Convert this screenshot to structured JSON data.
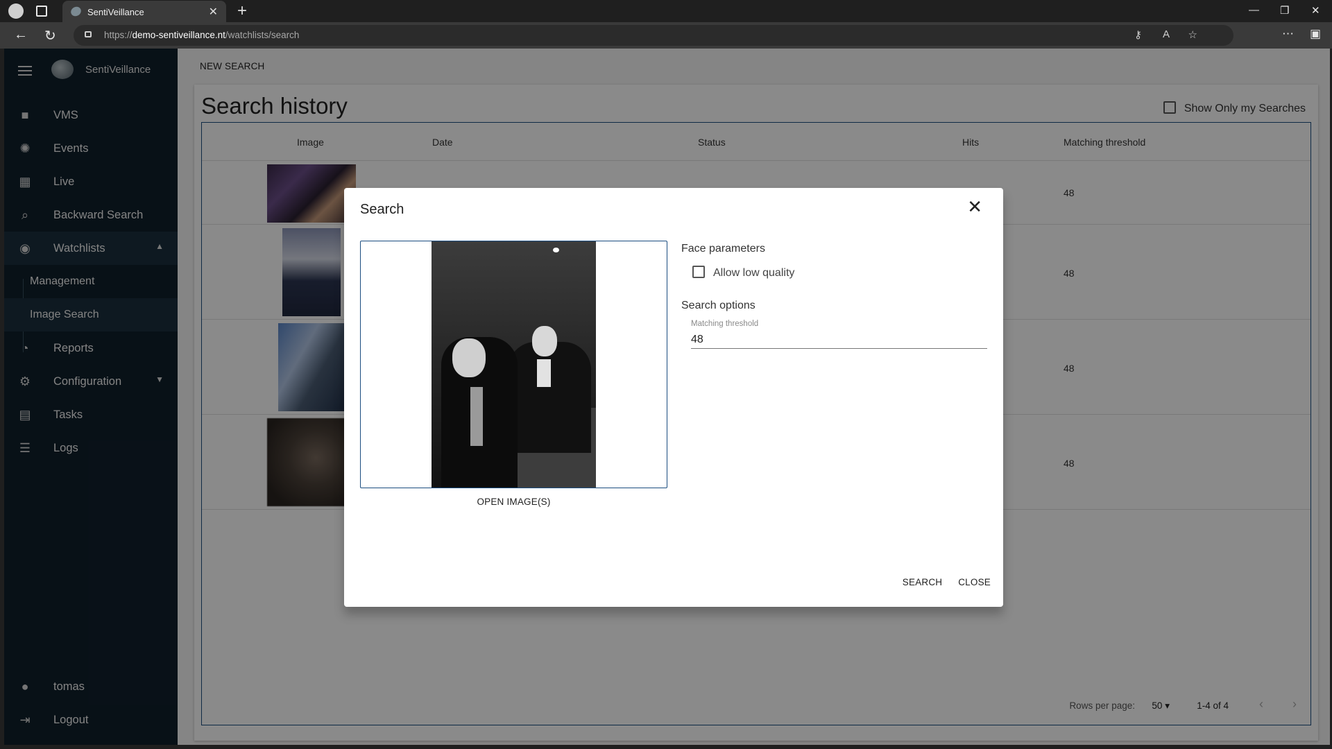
{
  "browser": {
    "tab_title": "SentiVeillance",
    "url_prefix": "https://",
    "url_host": "demo-sentiveillance.nt",
    "url_path": "/watchlists/search"
  },
  "sidebar": {
    "brand": "SentiVeillance",
    "items": [
      {
        "label": "VMS",
        "icon": "videocam-icon"
      },
      {
        "label": "Events",
        "icon": "aperture-icon"
      },
      {
        "label": "Live",
        "icon": "dashboard-icon"
      },
      {
        "label": "Backward Search",
        "icon": "search-icon"
      },
      {
        "label": "Watchlists",
        "icon": "eye-icon"
      },
      {
        "label": "Reports",
        "icon": "pie-chart-icon"
      },
      {
        "label": "Configuration",
        "icon": "gear-icon"
      },
      {
        "label": "Tasks",
        "icon": "clipboard-icon"
      },
      {
        "label": "Logs",
        "icon": "list-icon"
      }
    ],
    "watchlists_sub": [
      "Management",
      "Image Search"
    ],
    "user": "tomas",
    "logout": "Logout"
  },
  "main": {
    "new_search": "NEW SEARCH",
    "title": "Search history",
    "show_only_label": "Show Only my Searches",
    "columns": [
      "Image",
      "Date",
      "Status",
      "Hits",
      "Matching threshold"
    ],
    "rows": [
      {
        "threshold": "48"
      },
      {
        "threshold": "48"
      },
      {
        "threshold": "48"
      },
      {
        "threshold": "48"
      }
    ],
    "footer": {
      "rows_per_page_label": "Rows per page:",
      "rows_per_page": "50",
      "range": "1-4 of 4"
    }
  },
  "dialog": {
    "title": "Search",
    "open_images": "OPEN IMAGE(S)",
    "face_parameters": "Face parameters",
    "allow_low_quality": "Allow low quality",
    "search_options": "Search options",
    "matching_threshold_label": "Matching threshold",
    "matching_threshold_value": "48",
    "search_button": "SEARCH",
    "close_button": "CLOSE"
  },
  "colors": {
    "sidebar_bg": "#10202c",
    "accent_border": "#1b4d80"
  }
}
